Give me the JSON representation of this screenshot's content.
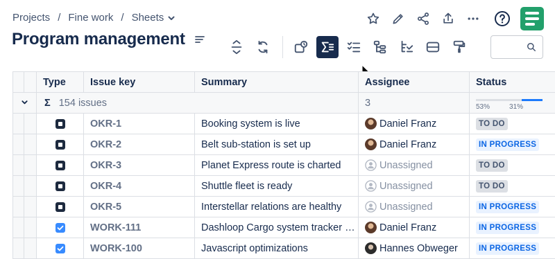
{
  "breadcrumb": {
    "items": [
      "Projects",
      "Fine work",
      "Sheets"
    ],
    "separator": "/"
  },
  "page": {
    "title": "Program management"
  },
  "top_actions": {
    "icons": [
      "star-icon",
      "edit-icon",
      "share-icon",
      "export-icon",
      "more-icon",
      "help-icon",
      "app-logo"
    ]
  },
  "toolbar": {
    "icons": [
      "collapse-rows-icon",
      "refresh-icon",
      "card-view-icon",
      "sum-icon",
      "checklist-icon",
      "hierarchy-icon",
      "tree-filter-icon",
      "row-height-icon",
      "format-paint-icon"
    ],
    "active": "sum-icon"
  },
  "search": {
    "value": "",
    "placeholder": ""
  },
  "table": {
    "columns": [
      "Type",
      "Issue key",
      "Summary",
      "Assignee",
      "Status"
    ],
    "group": {
      "sum_symbol": "Σ",
      "count_label": "154 issues",
      "assignee_count": "3",
      "status_progress": {
        "done_label": "53%",
        "in_progress_label": "31%",
        "in_progress_fraction": 0.31
      }
    },
    "rows": [
      {
        "type": "task",
        "key": "OKR-1",
        "summary": "Booking system is live",
        "assignee": "Daniel Franz",
        "avatar": "av1",
        "status": "TO DO",
        "status_kind": "todo"
      },
      {
        "type": "task",
        "key": "OKR-2",
        "summary": "Belt sub-station is set up",
        "assignee": "Daniel Franz",
        "avatar": "av1",
        "status": "IN PROGRESS",
        "status_kind": "prog"
      },
      {
        "type": "task",
        "key": "OKR-3",
        "summary": "Planet Express route is charted",
        "assignee": "Unassigned",
        "avatar": "none",
        "status": "TO DO",
        "status_kind": "todo"
      },
      {
        "type": "task",
        "key": "OKR-4",
        "summary": "Shuttle fleet is ready",
        "assignee": "Unassigned",
        "avatar": "none",
        "status": "TO DO",
        "status_kind": "todo"
      },
      {
        "type": "task",
        "key": "OKR-5",
        "summary": "Interstellar relations are healthy",
        "assignee": "Unassigned",
        "avatar": "none",
        "status": "IN PROGRESS",
        "status_kind": "prog"
      },
      {
        "type": "check",
        "key": "WORK-111",
        "summary": "Dashloop Cargo system tracker …",
        "assignee": "Daniel Franz",
        "avatar": "av1",
        "status": "IN PROGRESS",
        "status_kind": "prog"
      },
      {
        "type": "check",
        "key": "WORK-100",
        "summary": "Javascript optimizations",
        "assignee": "Hannes Obweger",
        "avatar": "av2",
        "status": "IN PROGRESS",
        "status_kind": "prog"
      }
    ]
  }
}
